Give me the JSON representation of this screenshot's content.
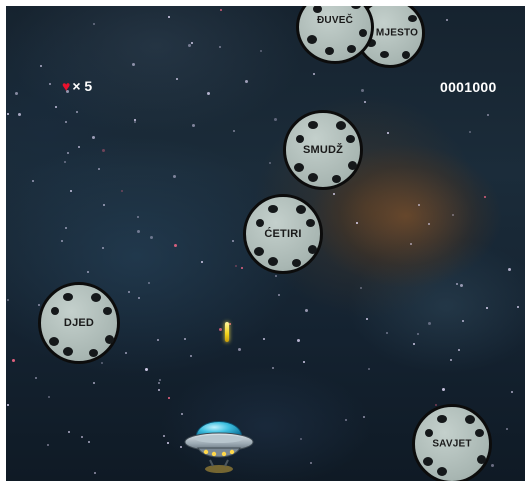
{
  "hud": {
    "lives_icon": "heart-icon",
    "lives_text": "× 5",
    "score": "0001000"
  },
  "asteroids": [
    {
      "word": "ĐUVEČ"
    },
    {
      "word": "MJESTO"
    },
    {
      "word": "SMUDŽ"
    },
    {
      "word": "ĆETIRI"
    },
    {
      "word": "DJED"
    },
    {
      "word": "SAVJET"
    }
  ],
  "player": {
    "icon": "ufo-icon"
  },
  "colors": {
    "asteroid_fill": "#a8b6b2",
    "asteroid_outline": "#0c0c0c",
    "heart": "#e8112d",
    "bullet": "#f2d21a",
    "ufo_dome": "#3fc0e0"
  }
}
